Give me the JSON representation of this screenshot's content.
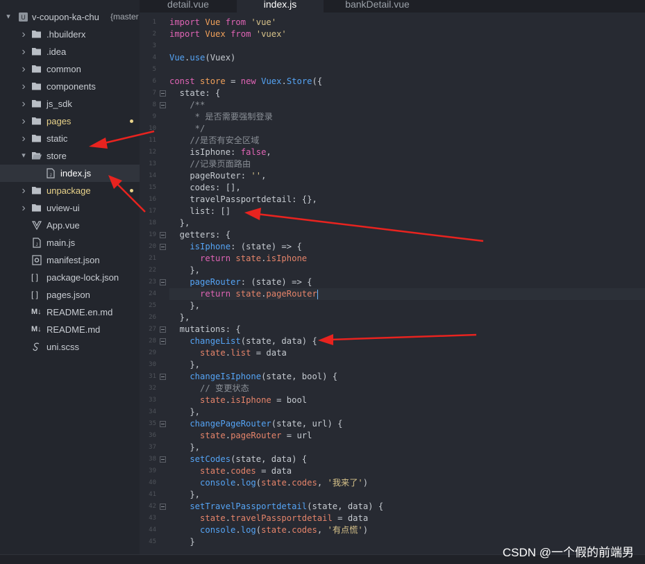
{
  "sidebar": {
    "project": {
      "name": "v-coupon-ka-chu",
      "branch": "{master"
    },
    "items": [
      {
        "label": "hbuilderx",
        "prefix": ".",
        "icon": "folder-icon",
        "type": "folder"
      },
      {
        "label": ".idea",
        "prefix": "",
        "icon": "folder-icon",
        "type": "folder"
      },
      {
        "label": "common",
        "prefix": "",
        "icon": "folder-icon",
        "type": "folder"
      },
      {
        "label": "components",
        "prefix": "",
        "icon": "folder-icon",
        "type": "folder"
      },
      {
        "label": "js_sdk",
        "prefix": "",
        "icon": "folder-icon",
        "type": "folder"
      },
      {
        "label": "pages",
        "prefix": "",
        "icon": "folder-icon",
        "type": "folder",
        "modified": true
      },
      {
        "label": "static",
        "prefix": "",
        "icon": "folder-icon",
        "type": "folder"
      },
      {
        "label": "store",
        "prefix": "",
        "icon": "folder-open-icon",
        "type": "folder",
        "open": true
      },
      {
        "label": "index.js",
        "prefix": "",
        "icon": "js-file-icon",
        "type": "file",
        "selected": true,
        "indent": true
      },
      {
        "label": "unpackage",
        "prefix": "",
        "icon": "folder-icon",
        "type": "folder",
        "modified": true
      },
      {
        "label": "uview-ui",
        "prefix": "",
        "icon": "folder-icon",
        "type": "folder"
      },
      {
        "label": "App.vue",
        "prefix": "",
        "icon": "vue-file-icon",
        "type": "file"
      },
      {
        "label": "main.js",
        "prefix": "",
        "icon": "js-file-icon",
        "type": "file"
      },
      {
        "label": "manifest.json",
        "prefix": "",
        "icon": "gear-file-icon",
        "type": "file"
      },
      {
        "label": "package-lock.json",
        "prefix": "",
        "icon": "json-file-icon",
        "type": "file"
      },
      {
        "label": "pages.json",
        "prefix": "",
        "icon": "json-file-icon",
        "type": "file"
      },
      {
        "label": "README.en.md",
        "prefix": "",
        "icon": "markdown-file-icon",
        "type": "file"
      },
      {
        "label": "README.md",
        "prefix": "",
        "icon": "markdown-file-icon",
        "type": "file"
      },
      {
        "label": "uni.scss",
        "prefix": "",
        "icon": "scss-file-icon",
        "type": "file"
      }
    ]
  },
  "tabs": [
    {
      "label": "detail.vue",
      "active": false
    },
    {
      "label": "index.js",
      "active": true
    },
    {
      "label": "bankDetail.vue",
      "active": false
    }
  ],
  "icons": {
    "json_brackets": "[ ]",
    "markdown": "M↓"
  },
  "code": [
    {
      "n": "1",
      "t": [
        [
          "k",
          "import "
        ],
        [
          "p",
          "Vue "
        ],
        [
          "k",
          "from "
        ],
        [
          "s",
          "'vue'"
        ]
      ]
    },
    {
      "n": "2",
      "t": [
        [
          "k",
          "import "
        ],
        [
          "p",
          "Vuex "
        ],
        [
          "k",
          "from "
        ],
        [
          "s",
          "'vuex'"
        ]
      ]
    },
    {
      "n": "3",
      "t": []
    },
    {
      "n": "4",
      "t": [
        [
          "f",
          "Vue"
        ],
        [
          "",
          "."
        ],
        [
          "f",
          "use"
        ],
        [
          "",
          "(Vuex)"
        ]
      ]
    },
    {
      "n": "5",
      "t": []
    },
    {
      "n": "6",
      "t": [
        [
          "k",
          "const "
        ],
        [
          "p",
          "store "
        ],
        [
          "",
          "= "
        ],
        [
          "k",
          "new "
        ],
        [
          "f",
          "Vuex"
        ],
        [
          "",
          "."
        ],
        [
          "f",
          "Store"
        ],
        [
          "",
          "({"
        ]
      ]
    },
    {
      "n": "7",
      "fold": true,
      "t": [
        [
          "",
          "  state: {"
        ]
      ]
    },
    {
      "n": "8",
      "fold": true,
      "t": [
        [
          "c",
          "    /**"
        ]
      ]
    },
    {
      "n": "9",
      "t": [
        [
          "c",
          "     * 是否需要强制登录"
        ]
      ]
    },
    {
      "n": "10",
      "t": [
        [
          "c",
          "     */"
        ]
      ]
    },
    {
      "n": "11",
      "t": [
        [
          "c",
          "    //是否有安全区域"
        ]
      ]
    },
    {
      "n": "12",
      "t": [
        [
          "",
          "    isIphone: "
        ],
        [
          "k",
          "false"
        ],
        [
          "",
          ","
        ]
      ]
    },
    {
      "n": "13",
      "t": [
        [
          "c",
          "    //记录页面路由"
        ]
      ]
    },
    {
      "n": "14",
      "t": [
        [
          "",
          "    pageRouter: "
        ],
        [
          "s",
          "''"
        ],
        [
          "",
          ","
        ]
      ]
    },
    {
      "n": "15",
      "t": [
        [
          "",
          "    codes: [],"
        ]
      ]
    },
    {
      "n": "16",
      "t": [
        [
          "",
          "    travelPassportdetail: {},"
        ]
      ]
    },
    {
      "n": "17",
      "t": [
        [
          "",
          "    list: []"
        ]
      ]
    },
    {
      "n": "18",
      "t": [
        [
          "",
          "  },"
        ]
      ]
    },
    {
      "n": "19",
      "fold": true,
      "t": [
        [
          "",
          "  getters: {"
        ]
      ]
    },
    {
      "n": "20",
      "fold": true,
      "t": [
        [
          "f",
          "    isIphone"
        ],
        [
          "",
          ": (state) => {"
        ]
      ]
    },
    {
      "n": "21",
      "t": [
        [
          "k",
          "      return "
        ],
        [
          "b",
          "state"
        ],
        [
          "",
          "."
        ],
        [
          "b",
          "isIphone"
        ]
      ]
    },
    {
      "n": "22",
      "t": [
        [
          "",
          "    },"
        ]
      ]
    },
    {
      "n": "23",
      "fold": true,
      "t": [
        [
          "f",
          "    pageRouter"
        ],
        [
          "",
          ": (state) => {"
        ]
      ]
    },
    {
      "n": "24",
      "cur": true,
      "t": [
        [
          "k",
          "      return "
        ],
        [
          "b",
          "state"
        ],
        [
          "",
          "."
        ],
        [
          "b",
          "pageRouter"
        ]
      ]
    },
    {
      "n": "25",
      "t": [
        [
          "",
          "    },"
        ]
      ]
    },
    {
      "n": "26",
      "t": [
        [
          "",
          "  },"
        ]
      ]
    },
    {
      "n": "27",
      "fold": true,
      "t": [
        [
          "",
          "  mutations: {"
        ]
      ]
    },
    {
      "n": "28",
      "fold": true,
      "t": [
        [
          "f",
          "    changeList"
        ],
        [
          "",
          "(state, data) {"
        ]
      ]
    },
    {
      "n": "29",
      "t": [
        [
          "b",
          "      state"
        ],
        [
          "",
          "."
        ],
        [
          "b",
          "list"
        ],
        [
          "",
          " = data"
        ]
      ]
    },
    {
      "n": "30",
      "t": [
        [
          "",
          "    },"
        ]
      ]
    },
    {
      "n": "31",
      "fold": true,
      "t": [
        [
          "f",
          "    changeIsIphone"
        ],
        [
          "",
          "(state, bool) {"
        ]
      ]
    },
    {
      "n": "32",
      "t": [
        [
          "c",
          "      // 变更状态"
        ]
      ]
    },
    {
      "n": "33",
      "t": [
        [
          "b",
          "      state"
        ],
        [
          "",
          "."
        ],
        [
          "b",
          "isIphone"
        ],
        [
          "",
          " = bool"
        ]
      ]
    },
    {
      "n": "34",
      "t": [
        [
          "",
          "    },"
        ]
      ]
    },
    {
      "n": "35",
      "fold": true,
      "t": [
        [
          "f",
          "    changePageRouter"
        ],
        [
          "",
          "(state, url) {"
        ]
      ]
    },
    {
      "n": "36",
      "t": [
        [
          "b",
          "      state"
        ],
        [
          "",
          "."
        ],
        [
          "b",
          "pageRouter"
        ],
        [
          "",
          " = url"
        ]
      ]
    },
    {
      "n": "37",
      "t": [
        [
          "",
          "    },"
        ]
      ]
    },
    {
      "n": "38",
      "fold": true,
      "t": [
        [
          "f",
          "    setCodes"
        ],
        [
          "",
          "(state, data) {"
        ]
      ]
    },
    {
      "n": "39",
      "t": [
        [
          "b",
          "      state"
        ],
        [
          "",
          "."
        ],
        [
          "b",
          "codes"
        ],
        [
          "",
          " = data"
        ]
      ]
    },
    {
      "n": "40",
      "t": [
        [
          "f",
          "      console"
        ],
        [
          "",
          "."
        ],
        [
          "f",
          "log"
        ],
        [
          "",
          "("
        ],
        [
          "b",
          "state"
        ],
        [
          "",
          "."
        ],
        [
          "b",
          "codes"
        ],
        [
          "",
          ", "
        ],
        [
          "s",
          "'我来了'"
        ],
        [
          "",
          ")"
        ]
      ]
    },
    {
      "n": "41",
      "t": [
        [
          "",
          "    },"
        ]
      ]
    },
    {
      "n": "42",
      "fold": true,
      "t": [
        [
          "f",
          "    setTravelPassportdetail"
        ],
        [
          "",
          "(state, data) {"
        ]
      ]
    },
    {
      "n": "43",
      "t": [
        [
          "b",
          "      state"
        ],
        [
          "",
          "."
        ],
        [
          "b",
          "travelPassportdetail"
        ],
        [
          "",
          " = data"
        ]
      ]
    },
    {
      "n": "44",
      "t": [
        [
          "f",
          "      console"
        ],
        [
          "",
          "."
        ],
        [
          "f",
          "log"
        ],
        [
          "",
          "("
        ],
        [
          "b",
          "state"
        ],
        [
          "",
          "."
        ],
        [
          "b",
          "codes"
        ],
        [
          "",
          ", "
        ],
        [
          "s",
          "'有点慌'"
        ],
        [
          "",
          ")"
        ]
      ]
    },
    {
      "n": "45",
      "t": [
        [
          "",
          "    }"
        ]
      ]
    }
  ],
  "watermark": "CSDN @一个假的前端男",
  "colors": {
    "arrow": "#e8231f",
    "keyword": "#e064b5",
    "string": "#d8c38a",
    "function": "#55a4f5",
    "modified_dot": "#e9d38a"
  }
}
